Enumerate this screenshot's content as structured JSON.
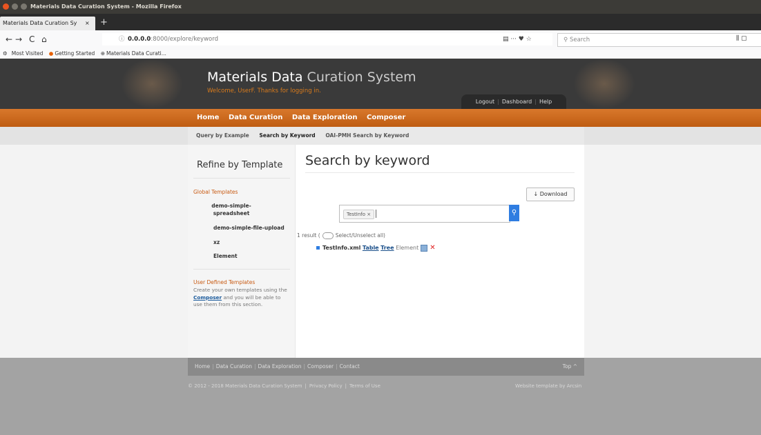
{
  "window": {
    "title": "Materials Data Curation System - Mozilla Firefox",
    "buttons": [
      {
        "name": "close",
        "color": "#e95420"
      },
      {
        "name": "minimize",
        "color": "#7a776f"
      },
      {
        "name": "maximize",
        "color": "#7a776f"
      }
    ]
  },
  "browser": {
    "tab_title": "Materials Data Curation Sy",
    "tab_close": "×",
    "new_tab": "+",
    "nav": {
      "back": "←",
      "forward": "→",
      "reload": "C",
      "home": "⌂"
    },
    "url_info": "ⓘ",
    "url_host": "0.0.0.0",
    "url_rest": ":8000/explore/keyword",
    "page_actions": "▤   ···  ♥  ☆",
    "search_placeholder": "Search",
    "right_icons": "⫼   ▢"
  },
  "bookmarks": [
    "Most Visited",
    "Getting Started",
    "Materials Data Curati..."
  ],
  "site": {
    "title_bold": "Materials Data",
    "title_light": "Curation System",
    "welcome": "Welcome, UserF. Thanks for logging in.",
    "usernav": [
      "Logout",
      "Dashboard",
      "Help"
    ]
  },
  "mainnav": [
    "Home",
    "Data Curation",
    "Data Exploration",
    "Composer"
  ],
  "subnav": [
    "Query by Example",
    "Search by Keyword",
    "OAI-PMH Search by Keyword"
  ],
  "sidebar": {
    "title": "Refine by Template",
    "global_heading": "Global Templates",
    "global_items": [
      "demo-simple-spreadsheet",
      "demo-simple-file-upload",
      "xz",
      "Element"
    ],
    "user_heading": "User Defined Templates",
    "user_text_before": "Create your own templates using the",
    "user_text_link": "Composer",
    "user_text_after": "and you will be able to use them from this section."
  },
  "main": {
    "heading": "Search by keyword",
    "download_label": "↓ Download",
    "keyword_chip": "TestInfo ×",
    "search_icon": "⚲",
    "result_count": "1 result (",
    "select_all": "Select/Unselect all)",
    "result": {
      "filename": "TestInfo.xml",
      "table": "Table",
      "tree": "Tree",
      "element": "Element",
      "delete": "✕"
    }
  },
  "footer": {
    "links": [
      "Home",
      "Data Curation",
      "Data Exploration",
      "Composer",
      "Contact"
    ],
    "top": "Top ^",
    "copyright": "© 2012 - 2018 Materials Data Curation System",
    "privacy": "Privacy Policy",
    "terms": "Terms of Use",
    "credit": "Website template by Arcsin"
  },
  "colors": {
    "accent_orange": "#c96a1e",
    "search_blue": "#2f7de1"
  }
}
